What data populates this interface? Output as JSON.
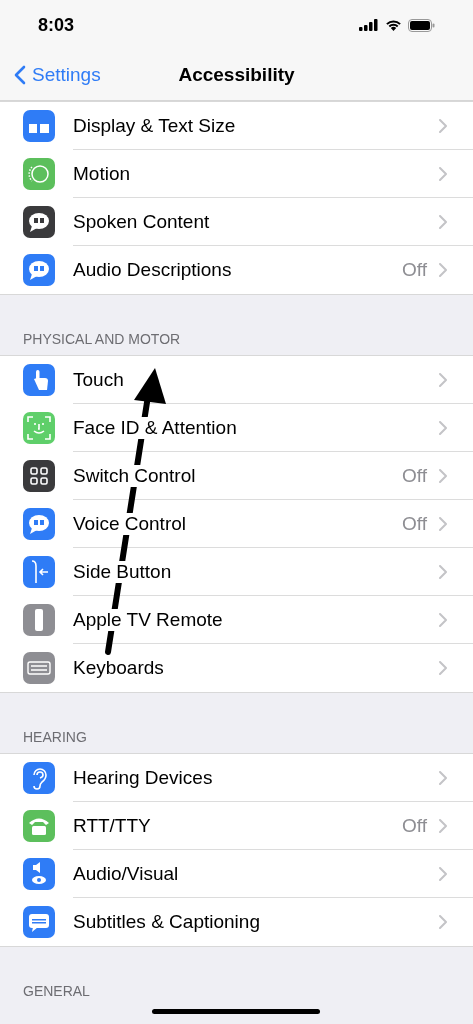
{
  "status_bar": {
    "time": "8:03"
  },
  "nav": {
    "back": "Settings",
    "title": "Accessibility"
  },
  "sections": [
    {
      "rows": [
        {
          "label": "Display & Text Size"
        },
        {
          "label": "Motion"
        },
        {
          "label": "Spoken Content"
        },
        {
          "label": "Audio Descriptions",
          "value": "Off"
        }
      ]
    },
    {
      "header": "PHYSICAL AND MOTOR",
      "rows": [
        {
          "label": "Touch"
        },
        {
          "label": "Face ID & Attention"
        },
        {
          "label": "Switch Control",
          "value": "Off"
        },
        {
          "label": "Voice Control",
          "value": "Off"
        },
        {
          "label": "Side Button"
        },
        {
          "label": "Apple TV Remote"
        },
        {
          "label": "Keyboards"
        }
      ]
    },
    {
      "header": "HEARING",
      "rows": [
        {
          "label": "Hearing Devices"
        },
        {
          "label": "RTT/TTY",
          "value": "Off"
        },
        {
          "label": "Audio/Visual"
        },
        {
          "label": "Subtitles & Captioning"
        }
      ]
    },
    {
      "header": "GENERAL"
    }
  ]
}
